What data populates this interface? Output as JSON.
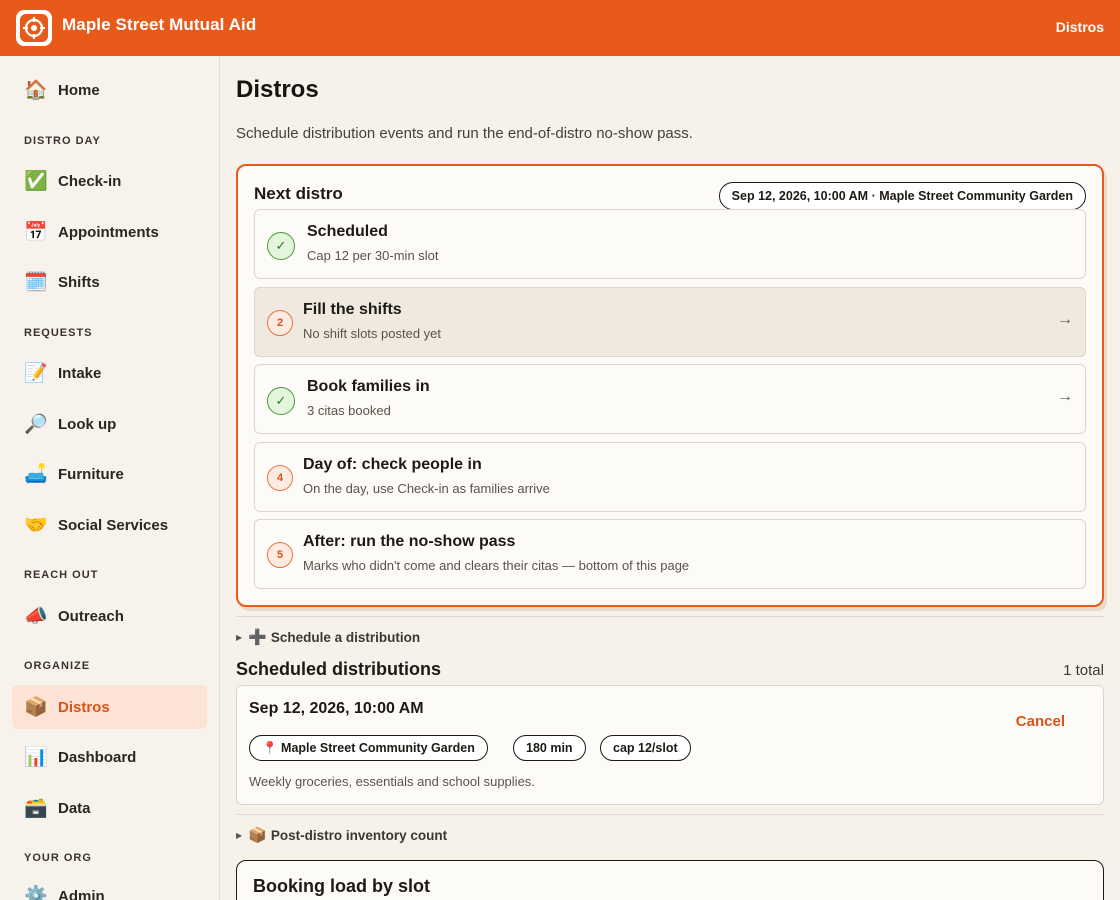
{
  "header": {
    "app_title": "Maple Street Mutual Aid",
    "top_link": "Distros"
  },
  "sidebar": {
    "home": {
      "label": "Home",
      "icon": "🏠"
    },
    "sections": {
      "distro_day": "DISTRO DAY",
      "requests": "REQUESTS",
      "reach_out": "REACH OUT",
      "organize": "ORGANIZE",
      "your_org": "YOUR ORG"
    },
    "items": {
      "checkin": {
        "label": "Check-in",
        "icon": "✅"
      },
      "appointments": {
        "label": "Appointments",
        "icon": "📅"
      },
      "shifts": {
        "label": "Shifts",
        "icon": "🗓️"
      },
      "intake": {
        "label": "Intake",
        "icon": "📝"
      },
      "lookup": {
        "label": "Look up",
        "icon": "🔎"
      },
      "furniture": {
        "label": "Furniture",
        "icon": "🛋️"
      },
      "social": {
        "label": "Social Services",
        "icon": "🤝"
      },
      "outreach": {
        "label": "Outreach",
        "icon": "📣"
      },
      "distros": {
        "label": "Distros",
        "icon": "📦"
      },
      "dashboard": {
        "label": "Dashboard",
        "icon": "📊"
      },
      "data": {
        "label": "Data",
        "icon": "🗃️"
      },
      "admin": {
        "label": "Admin",
        "icon": "⚙️"
      }
    }
  },
  "main": {
    "title": "Distros",
    "subtitle": "Schedule distribution events and run the end-of-distro no-show pass.",
    "next_distro": {
      "title": "Next distro",
      "pill": "Sep 12, 2026, 10:00 AM · Maple Street Community Garden",
      "steps": [
        {
          "marker": "✓",
          "state": "done",
          "title": "Scheduled",
          "sub": "Cap 12 per 30-min slot"
        },
        {
          "marker": "2",
          "state": "todo",
          "title": "Fill the shifts",
          "sub": "No shift slots posted yet",
          "arrow": "→"
        },
        {
          "marker": "✓",
          "state": "done",
          "title": "Book families in",
          "sub": "3 citas booked",
          "arrow": "→"
        },
        {
          "marker": "4",
          "state": "todo",
          "title": "Day of: check people in",
          "sub": "On the day, use Check-in as families arrive"
        },
        {
          "marker": "5",
          "state": "todo",
          "title": "After: run the no-show pass",
          "sub": "Marks who didn't come and clears their citas — bottom of this page"
        }
      ]
    },
    "schedule_disclosure": {
      "icon": "➕",
      "label": "Schedule a distribution"
    },
    "scheduled": {
      "title": "Scheduled distributions",
      "count": "1 total",
      "item": {
        "date": "Sep 12, 2026, 10:00 AM",
        "cancel": "Cancel",
        "location": "📍 Maple Street Community Garden",
        "duration": "180 min",
        "cap": "cap 12/slot",
        "note": "Weekly groceries, essentials and school supplies."
      }
    },
    "inventory_disclosure": {
      "icon": "📦",
      "label": "Post-distro inventory count"
    },
    "booking_load": {
      "title": "Booking load by slot"
    }
  }
}
